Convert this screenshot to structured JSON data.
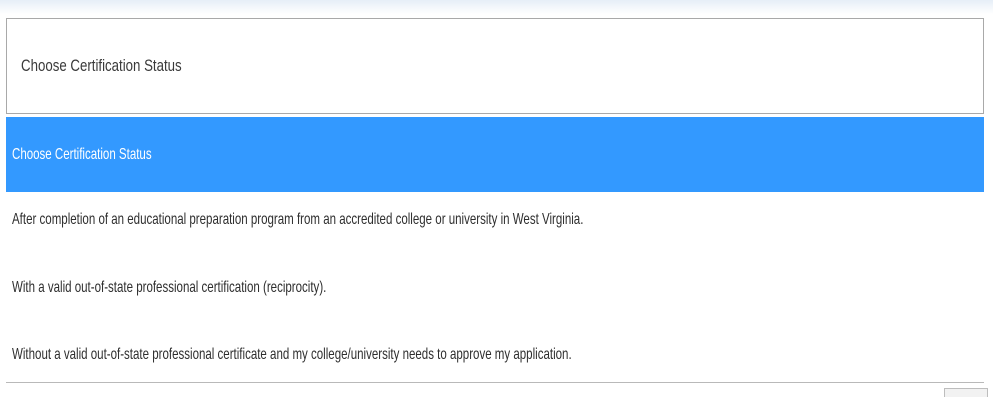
{
  "select": {
    "value": "Choose Certification Status"
  },
  "options": [
    {
      "label": "Choose Certification Status",
      "selected": true
    },
    {
      "label": "After completion of an educational preparation program from an accredited college or university in West Virginia.",
      "selected": false
    },
    {
      "label": "With a valid out-of-state professional certification (reciprocity).",
      "selected": false
    },
    {
      "label": "Without a valid out-of-state professional certificate and my college/university needs to approve my application.",
      "selected": false
    }
  ],
  "colors": {
    "highlight": "#3399ff",
    "border": "#a9a9a9",
    "text": "#2e2e2e"
  }
}
